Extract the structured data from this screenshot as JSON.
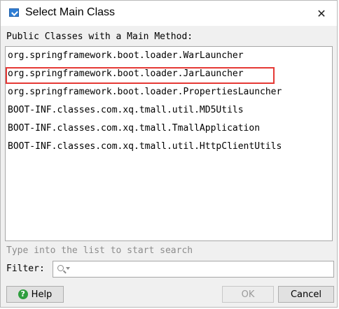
{
  "window": {
    "title": "Select Main Class",
    "close_glyph": "✕"
  },
  "section_label": "Public Classes with a Main Method:",
  "classes": [
    "org.springframework.boot.loader.WarLauncher",
    "org.springframework.boot.loader.JarLauncher",
    "org.springframework.boot.loader.PropertiesLauncher",
    "BOOT-INF.classes.com.xq.tmall.util.MD5Utils",
    "BOOT-INF.classes.com.xq.tmall.TmallApplication",
    "BOOT-INF.classes.com.xq.tmall.util.HttpClientUtils"
  ],
  "highlighted_index": 1,
  "hint": "Type into the list to start search",
  "filter": {
    "label": "Filter:",
    "value": ""
  },
  "buttons": {
    "help_glyph": "?",
    "help": "Help",
    "ok": "OK",
    "cancel": "Cancel"
  },
  "colors": {
    "highlight_border": "#e53935",
    "help_icon": "#2e9e3e"
  }
}
